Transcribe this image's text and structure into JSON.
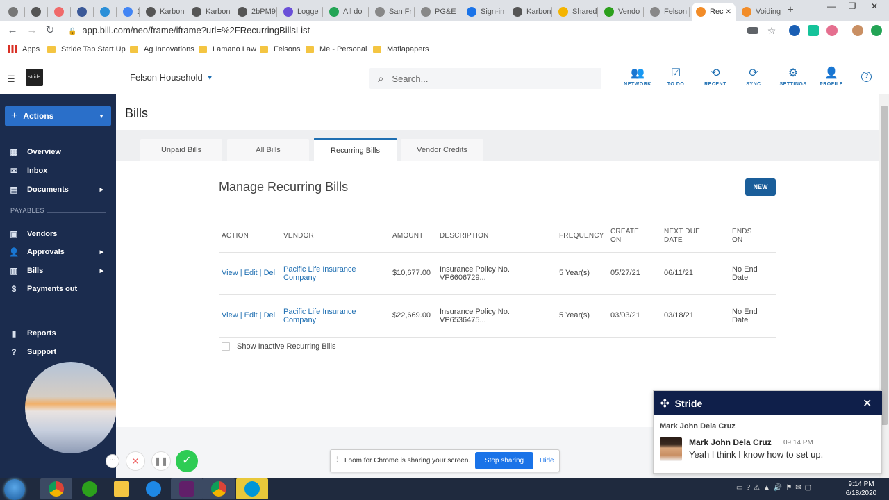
{
  "browser": {
    "tabs": [
      {
        "label": "",
        "color": "#777"
      },
      {
        "label": "",
        "color": "#555"
      },
      {
        "label": "",
        "color": "#f06a6a"
      },
      {
        "label": "",
        "color": "#3b5998"
      },
      {
        "label": "",
        "color": "#2a8fd8"
      },
      {
        "label": "18",
        "color": "#4285f4"
      },
      {
        "label": "Karbon",
        "color": "#555"
      },
      {
        "label": "Karbon",
        "color": "#555"
      },
      {
        "label": "2bPM9",
        "color": "#555"
      },
      {
        "label": "Logge",
        "color": "#6a4fd8"
      },
      {
        "label": "All do",
        "color": "#23a455"
      },
      {
        "label": "San Fr",
        "color": "#888"
      },
      {
        "label": "PG&E",
        "color": "#888"
      },
      {
        "label": "Sign-in",
        "color": "#1a73e8"
      },
      {
        "label": "Karbon",
        "color": "#555"
      },
      {
        "label": "Shared",
        "color": "#f4b400"
      },
      {
        "label": "Vendo",
        "color": "#2ca01c"
      },
      {
        "label": "Felson",
        "color": "#888"
      },
      {
        "label": "Rec",
        "color": "#f28c28",
        "active": true
      },
      {
        "label": "Voiding",
        "color": "#f28c28"
      }
    ],
    "url": "app.bill.com/neo/frame/iframe?url=%2FRecurringBillsList",
    "bookmarks": [
      "Apps",
      "Stride Tab Start Up",
      "Ag Innovations",
      "Lamano Law",
      "Felsons",
      "Me - Personal",
      "Mafiapapers"
    ]
  },
  "header": {
    "logo": "stride",
    "household": "Felson Household",
    "search_placeholder": "Search...",
    "icons": [
      {
        "label": "NETWORK",
        "icon": "network-icon"
      },
      {
        "label": "TO DO",
        "icon": "checkbox-icon"
      },
      {
        "label": "RECENT",
        "icon": "history-icon"
      },
      {
        "label": "SYNC",
        "icon": "sync-icon"
      },
      {
        "label": "SETTINGS",
        "icon": "gear-icon"
      },
      {
        "label": "PROFILE",
        "icon": "profile-icon"
      }
    ]
  },
  "sidebar": {
    "actions_label": "Actions",
    "items": [
      {
        "label": "Overview",
        "icon": "grid-icon"
      },
      {
        "label": "Inbox",
        "icon": "mail-icon"
      },
      {
        "label": "Documents",
        "icon": "documents-icon",
        "has_submenu": true
      },
      {
        "label": "Vendors",
        "icon": "vendors-icon"
      },
      {
        "label": "Approvals",
        "icon": "approvals-icon",
        "has_submenu": true
      },
      {
        "label": "Bills",
        "icon": "bills-icon",
        "has_submenu": true
      },
      {
        "label": "Payments out",
        "icon": "payments-icon"
      },
      {
        "label": "Reports",
        "icon": "reports-icon"
      },
      {
        "label": "Support",
        "icon": "support-icon"
      }
    ],
    "section_payables": "PAYABLES"
  },
  "main": {
    "title": "Bills",
    "tabs": [
      "Unpaid Bills",
      "All Bills",
      "Recurring Bills",
      "Vendor Credits"
    ],
    "active_tab": "Recurring Bills",
    "section_title": "Manage Recurring Bills",
    "new_button": "NEW",
    "table": {
      "headers": [
        "ACTION",
        "VENDOR",
        "AMOUNT",
        "DESCRIPTION",
        "FREQUENCY",
        "CREATE ON",
        "NEXT DUE DATE",
        "ENDS ON"
      ],
      "rows": [
        {
          "action_view": "View",
          "action_edit": "Edit",
          "action_del": "Del",
          "vendor": "Pacific Life Insurance Company",
          "amount": "$10,677.00",
          "description": "Insurance Policy No. VP6606729...",
          "frequency": "5 Year(s)",
          "create_on": "05/27/21",
          "next_due": "06/11/21",
          "ends_on": "No End Date"
        },
        {
          "action_view": "View",
          "action_edit": "Edit",
          "action_del": "Del",
          "vendor": "Pacific Life Insurance Company",
          "amount": "$22,669.00",
          "description": "Insurance Policy No. VP6536475...",
          "frequency": "5 Year(s)",
          "create_on": "03/03/21",
          "next_due": "03/18/21",
          "ends_on": "No End Date"
        }
      ]
    },
    "show_inactive_label": "Show Inactive Recurring Bills"
  },
  "loom": {
    "message": "Loom for Chrome is sharing your screen.",
    "stop_label": "Stop sharing",
    "hide_label": "Hide"
  },
  "chat": {
    "app_name": "Stride",
    "contact": "Mark John Dela Cruz",
    "message_author": "Mark John Dela Cruz",
    "message_time": "09:14 PM",
    "message_text": "Yeah I think I know how to set up."
  },
  "taskbar": {
    "time": "9:14 PM",
    "date": "6/18/2020"
  }
}
